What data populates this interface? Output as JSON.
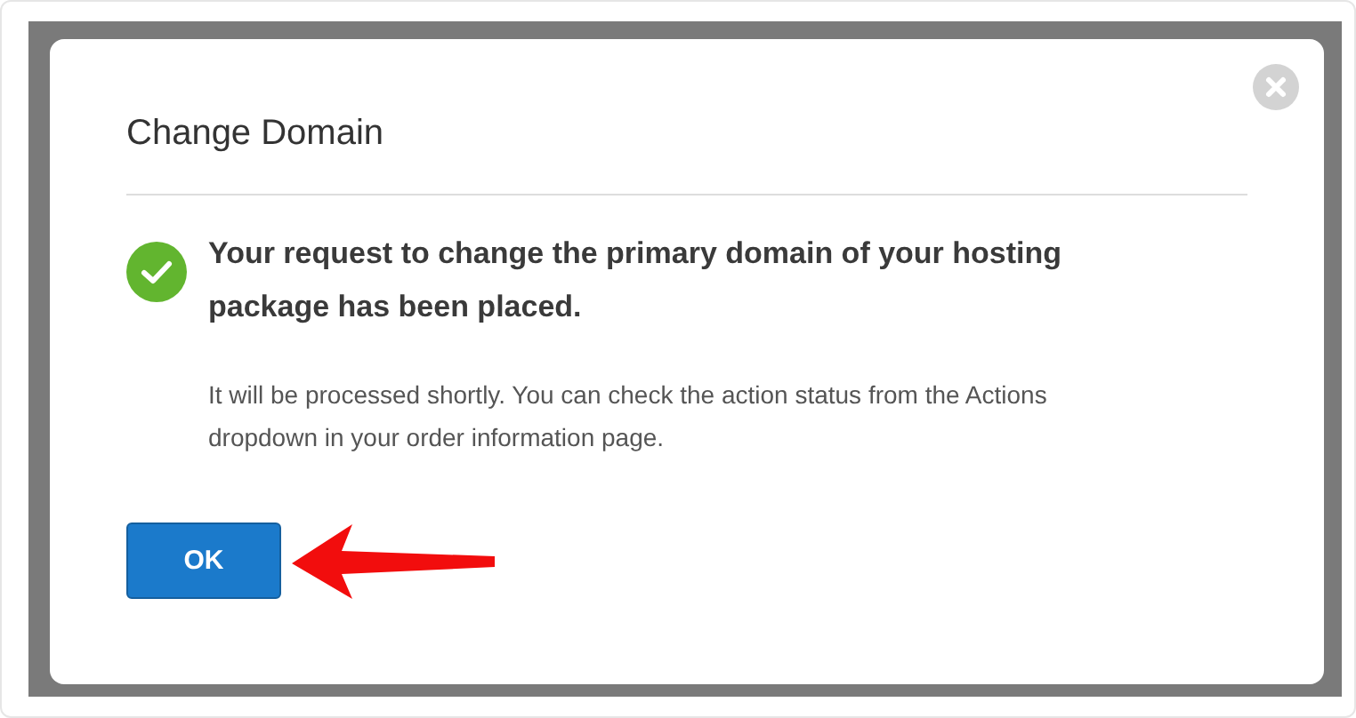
{
  "dialog": {
    "title": "Change Domain",
    "kind": "success",
    "heading": "Your request to change the primary domain of your hosting package has been placed.",
    "body": "It will be processed shortly. You can check the action status from the Actions dropdown in your order information page.",
    "buttons": [
      {
        "label": "OK",
        "kind": "primary"
      }
    ]
  }
}
